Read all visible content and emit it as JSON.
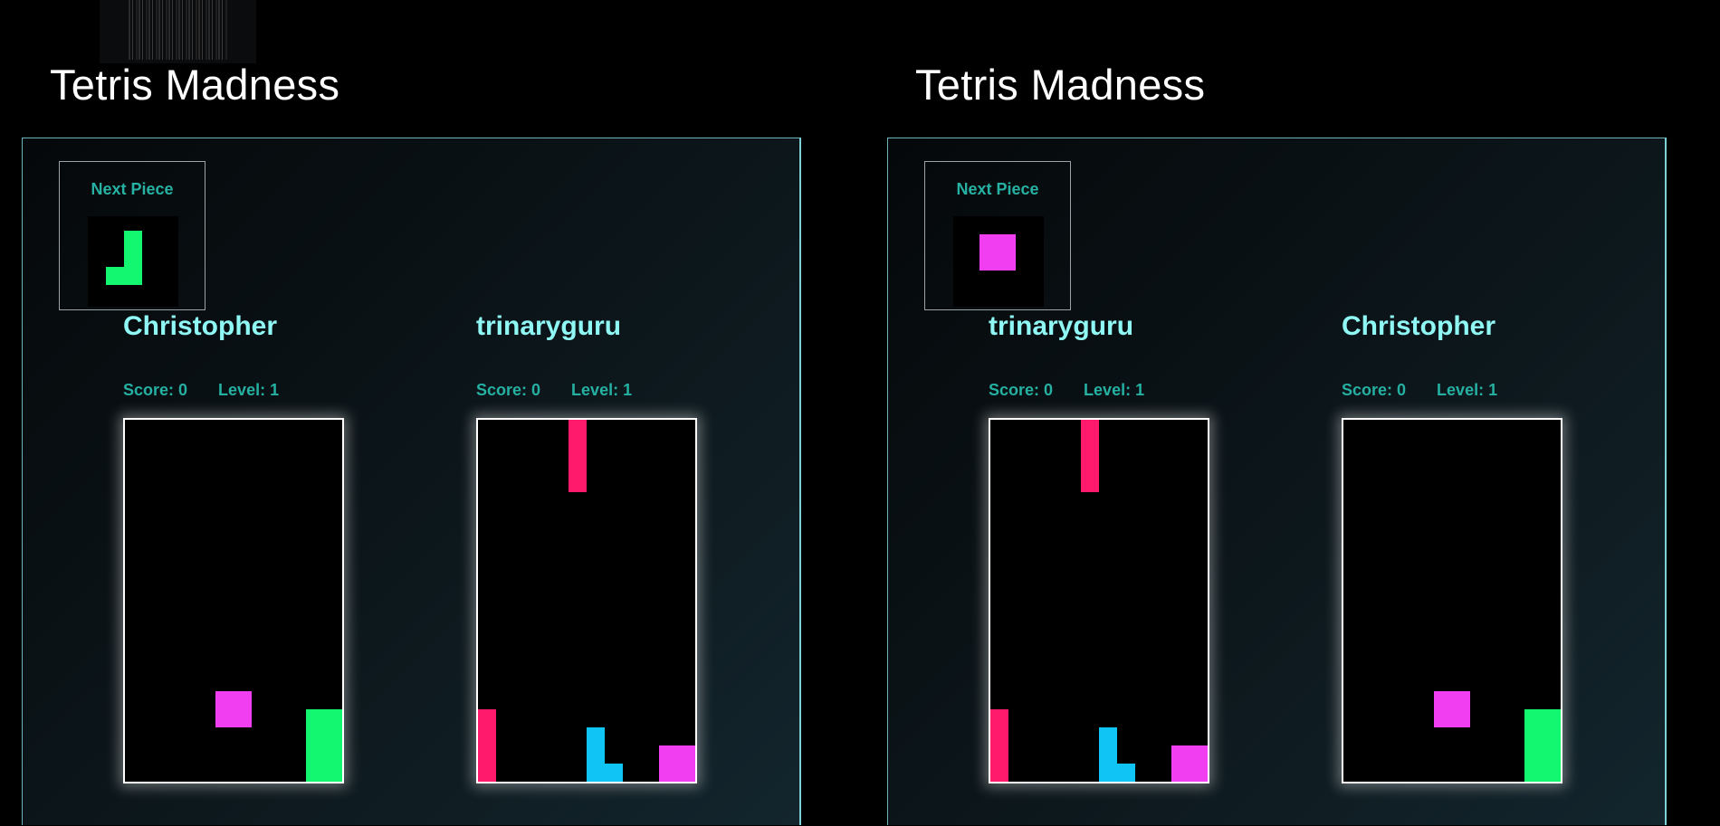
{
  "colors": {
    "green": "#13f66f",
    "magenta": "#f23ef1",
    "pink": "#ff1a6b",
    "cyan": "#11c4f6",
    "player_name": "#8ff7f4",
    "stats_text": "#25b0a2"
  },
  "games": [
    {
      "title": "Tetris Madness",
      "next_piece": {
        "label": "Next Piece",
        "icon": "j-piece-icon",
        "color": "#13f66f"
      },
      "players": [
        {
          "name": "Christopher",
          "score_label": "Score: 0",
          "level_label": "Level: 1",
          "score": 0,
          "level": 1,
          "pieces": [
            {
              "icon": "o-piece-icon",
              "color": "#f23ef1"
            },
            {
              "icon": "l-piece-icon",
              "color": "#13f66f"
            }
          ]
        },
        {
          "name": "trinaryguru",
          "score_label": "Score: 0",
          "level_label": "Level: 1",
          "score": 0,
          "level": 1,
          "pieces": [
            {
              "icon": "i-piece-icon",
              "color": "#ff1a6b"
            },
            {
              "icon": "i-piece-icon",
              "color": "#ff1a6b"
            },
            {
              "icon": "l-piece-icon",
              "color": "#11c4f6"
            },
            {
              "icon": "o-piece-icon",
              "color": "#f23ef1"
            }
          ]
        }
      ]
    },
    {
      "title": "Tetris Madness",
      "next_piece": {
        "label": "Next Piece",
        "icon": "o-piece-icon",
        "color": "#f23ef1"
      },
      "players": [
        {
          "name": "trinaryguru",
          "score_label": "Score: 0",
          "level_label": "Level: 1",
          "score": 0,
          "level": 1,
          "pieces": [
            {
              "icon": "i-piece-icon",
              "color": "#ff1a6b"
            },
            {
              "icon": "i-piece-icon",
              "color": "#ff1a6b"
            },
            {
              "icon": "l-piece-icon",
              "color": "#11c4f6"
            },
            {
              "icon": "o-piece-icon",
              "color": "#f23ef1"
            }
          ]
        },
        {
          "name": "Christopher",
          "score_label": "Score: 0",
          "level_label": "Level: 1",
          "score": 0,
          "level": 1,
          "pieces": [
            {
              "icon": "o-piece-icon",
              "color": "#f23ef1"
            },
            {
              "icon": "l-piece-icon",
              "color": "#13f66f"
            }
          ]
        }
      ]
    }
  ]
}
